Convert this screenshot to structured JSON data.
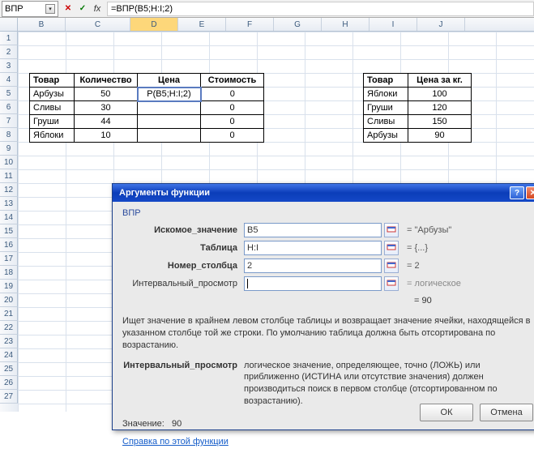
{
  "formula_bar": {
    "name_box": "ВПР",
    "cancel_glyph": "✕",
    "confirm_glyph": "✓",
    "fx_label": "fx",
    "formula": "=ВПР(B5;H:I;2)"
  },
  "columns": [
    "B",
    "C",
    "D",
    "E",
    "F",
    "G",
    "H",
    "I",
    "J"
  ],
  "active_column": "D",
  "rows": 27,
  "table1": {
    "headers": {
      "item": "Товар",
      "qty": "Количество",
      "price": "Цена",
      "cost": "Стоимость"
    },
    "rows": [
      {
        "item": "Арбузы",
        "qty": "50",
        "price": "Р(B5;H:I;2)",
        "cost": "0",
        "sel": true
      },
      {
        "item": "Сливы",
        "qty": "30",
        "price": "",
        "cost": "0"
      },
      {
        "item": "Груши",
        "qty": "44",
        "price": "",
        "cost": "0"
      },
      {
        "item": "Яблоки",
        "qty": "10",
        "price": "",
        "cost": "0"
      }
    ]
  },
  "table2": {
    "headers": {
      "item": "Товар",
      "price": "Цена за кг."
    },
    "rows": [
      {
        "item": "Яблоки",
        "price": "100"
      },
      {
        "item": "Груши",
        "price": "120"
      },
      {
        "item": "Сливы",
        "price": "150"
      },
      {
        "item": "Арбузы",
        "price": "90"
      }
    ]
  },
  "dialog": {
    "title": "Аргументы функции",
    "help_glyph": "?",
    "close_glyph": "✕",
    "fn_name": "ВПР",
    "args": {
      "lookup": {
        "label": "Искомое_значение",
        "value": "B5",
        "result": "= \"Арбузы\""
      },
      "table": {
        "label": "Таблица",
        "value": "H:I",
        "result": "= {...}"
      },
      "col": {
        "label": "Номер_столбца",
        "value": "2",
        "result": "= 2"
      },
      "range": {
        "label": "Интервальный_просмотр",
        "value": "",
        "result": "= логическое"
      }
    },
    "intermediate_result": "= 90",
    "description": "Ищет значение в крайнем левом столбце таблицы и возвращает значение ячейки, находящейся в указанном столбце той же строки. По умолчанию таблица должна быть отсортирована по возрастанию.",
    "arg_help": {
      "label": "Интервальный_просмотр",
      "text": "логическое значение, определяющее, точно (ЛОЖЬ) или приближенно (ИСТИНА или отсутствие значения) должен производиться поиск в первом столбце (отсортированном по возрастанию)."
    },
    "result_label": "Значение:",
    "result_value": "90",
    "help_link": "Справка по этой функции",
    "ok": "ОК",
    "cancel": "Отмена"
  }
}
